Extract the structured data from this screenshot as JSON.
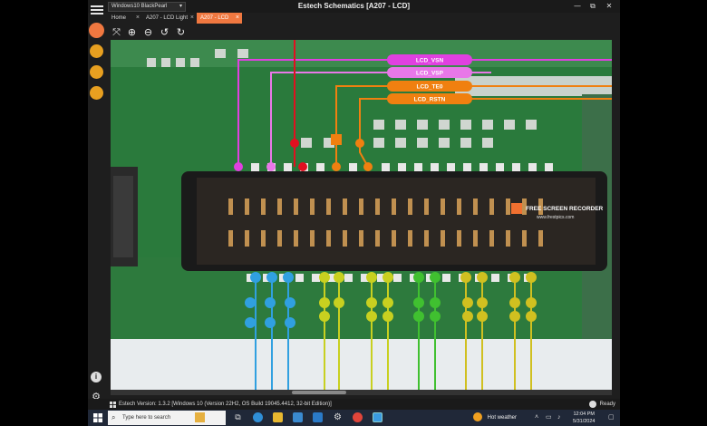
{
  "window": {
    "title": "Estech Schematics [A207 - LCD]",
    "controls": [
      "—",
      "⧉",
      "✕"
    ]
  },
  "profile_select": {
    "value": "Windows10 BlackPearl"
  },
  "tabs": [
    {
      "label": "Home",
      "active": false
    },
    {
      "label": "A207 - LCD Light",
      "active": false
    },
    {
      "label": "A207 - LCD",
      "active": true
    }
  ],
  "toolbar": {
    "icons": [
      "fit-screen-icon",
      "zoom-in-icon",
      "zoom-out-icon",
      "undo-icon",
      "redo-icon"
    ]
  },
  "sidebar": {
    "top_icons": [
      "pcb-view-icon",
      "pin-icon",
      "grid-icon",
      "settings-icon"
    ],
    "bottom_icons": [
      "info-icon",
      "gear-icon"
    ]
  },
  "schematic": {
    "nets": [
      {
        "name": "LCD_VSN",
        "color": "#e040e0"
      },
      {
        "name": "LCD_VSP",
        "color": "#e070e0"
      },
      {
        "name": "LCD_TE0",
        "color": "#f08010"
      },
      {
        "name": "LCD_RSTN",
        "color": "#f08010"
      }
    ],
    "watermark": {
      "line1": "FREE SCREEN RECORDER",
      "line2": "www.frestpics.com"
    }
  },
  "statusbar": {
    "text": "Estech Version: 1.3.2 [Windows 10 (Version 22H2, OS Build 19045.4412, 32-bit Edition)]",
    "ready": "Ready"
  },
  "taskbar": {
    "search_placeholder": "Type here to search",
    "weather": "Hot weather",
    "time": "12:04 PM",
    "date": "5/31/2024"
  },
  "colors": {
    "accent": "#f07840",
    "board": "#276f38",
    "magenta": "#e040e0",
    "orange": "#f08010",
    "red": "#e01020",
    "blue": "#30a0e0",
    "yellow": "#d0d020",
    "green": "#40c030"
  }
}
